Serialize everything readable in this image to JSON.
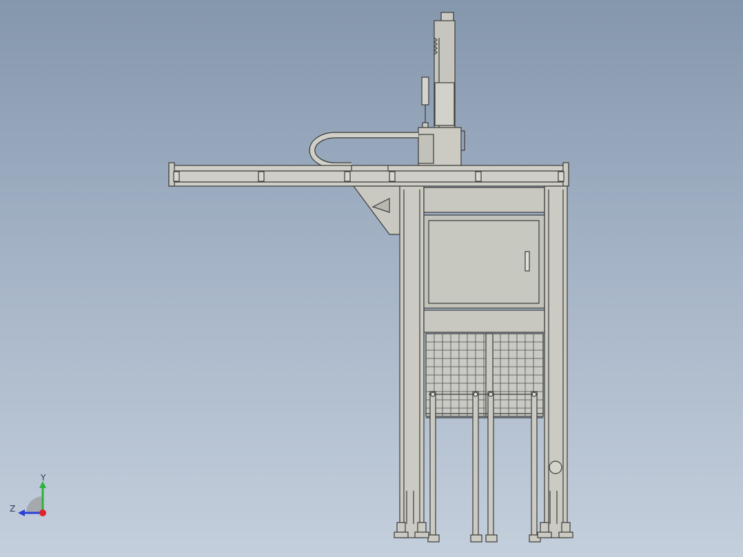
{
  "viewport": {
    "background_top": "#8597ad",
    "background_bottom": "#c4cfdc",
    "model": {
      "name": "gantry-machine-assembly",
      "body_color": "#cbcbc3",
      "panel_color": "#bfc0b8",
      "line_color": "#3a3a3a"
    },
    "triad": {
      "y_label": "Y",
      "z_label": "Z",
      "y_color": "#2bb33a",
      "z_color": "#2a3fd6",
      "x_color": "#e0222a"
    }
  }
}
